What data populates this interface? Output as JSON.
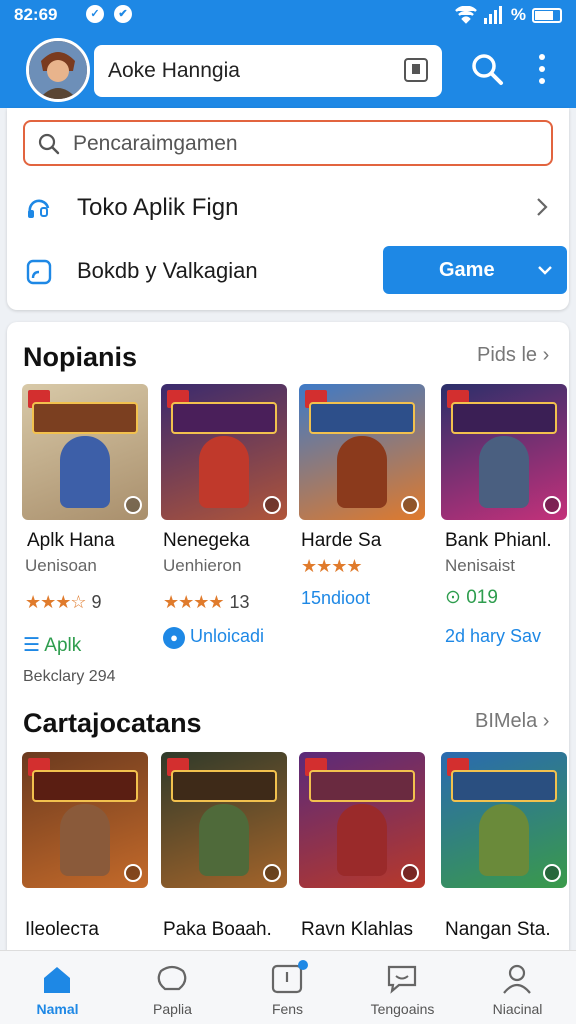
{
  "status": {
    "time": "82:69",
    "battery_text": "%"
  },
  "header": {
    "title": "Aoke Hanngia"
  },
  "search": {
    "placeholder": "Pencaraimgamen"
  },
  "menu": {
    "item1": "Toko Aplik Fign",
    "item2": "Bokdb y Valkagian",
    "button": "Game"
  },
  "sections": [
    {
      "title": "Nopianis",
      "more": "Pids le",
      "games": [
        {
          "name": "Aplk Hana",
          "sub": "Uenisoan",
          "stars": "★★★☆",
          "count": "9",
          "extra": "Aplk",
          "caption": "Bekclary 294"
        },
        {
          "name": "Nenegeka",
          "sub": "Uenhieron",
          "stars": "★★★★",
          "count": "13",
          "extra": "Unloicadi"
        },
        {
          "name": "Harde Sa",
          "stars": "★★★★",
          "extra": "15ndioot"
        },
        {
          "name": "Bank Phianl.",
          "sub": "Nenisaist",
          "extra": "019",
          "extra2": "2d hary Sav"
        }
      ]
    },
    {
      "title": "Cartajocatans",
      "more": "BIMela",
      "games": [
        {
          "name": "Ileoleста"
        },
        {
          "name": "Paka Boaah."
        },
        {
          "name": "Ravn Klahlas"
        },
        {
          "name": "Nangan Sta."
        }
      ]
    }
  ],
  "nav": [
    {
      "label": "Namal",
      "icon": "home-icon"
    },
    {
      "label": "Paplia",
      "icon": "apps-icon"
    },
    {
      "label": "Fens",
      "icon": "updates-icon"
    },
    {
      "label": "Tengoains",
      "icon": "chat-icon"
    },
    {
      "label": "Niacinal",
      "icon": "profile-icon"
    }
  ],
  "colors": {
    "accent": "#1e88e5",
    "search_border": "#e2643f",
    "star": "#e07b2c",
    "green": "#2e9d4e"
  }
}
